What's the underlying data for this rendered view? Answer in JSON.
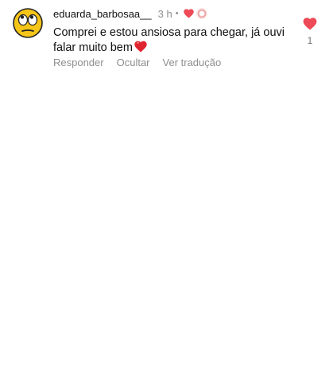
{
  "comment": {
    "username": "eduarda_barbosaa__",
    "time": "3 h",
    "separator": "•",
    "text": "Comprei e estou ansiosa para chegar, já ouvi falar muito bem",
    "like_count": "1",
    "actions": {
      "reply": "Responder",
      "hide": "Ocultar",
      "translate": "Ver tradução"
    },
    "emoji": "heart-emoji"
  },
  "icons": {
    "avatar": "eyes-rolling-emoji-avatar",
    "liked_by_author": "heart-icon",
    "author_badge": "author-avatar-ring",
    "like": "heart-icon"
  },
  "colors": {
    "heart": "#ed4956",
    "secondary_text": "#8e8e8e",
    "primary_text": "#111111",
    "background": "#ffffff"
  }
}
